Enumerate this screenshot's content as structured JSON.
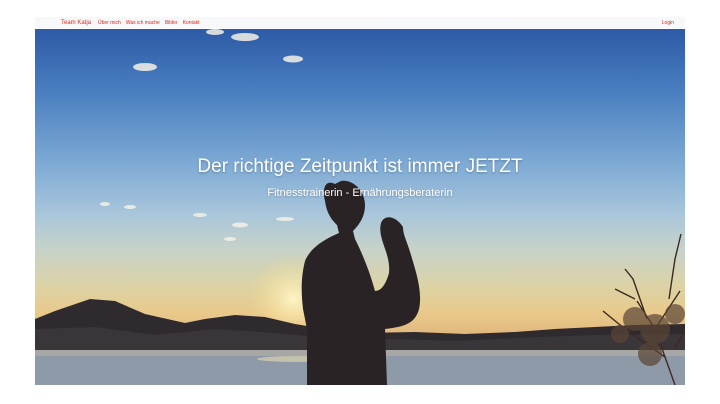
{
  "navbar": {
    "brand": "Team Katja",
    "links": [
      "Über mich",
      "Was ich mache",
      "Bilder",
      "Kontakt"
    ],
    "login": "Login"
  },
  "hero": {
    "headline": "Der richtige Zeitpunkt ist immer JETZT",
    "subtitle": "Fitnesstrainerin - Ernährungsberaterin"
  },
  "colors": {
    "accent": "#d62b20",
    "navbar_bg": "#f7f8f9"
  }
}
